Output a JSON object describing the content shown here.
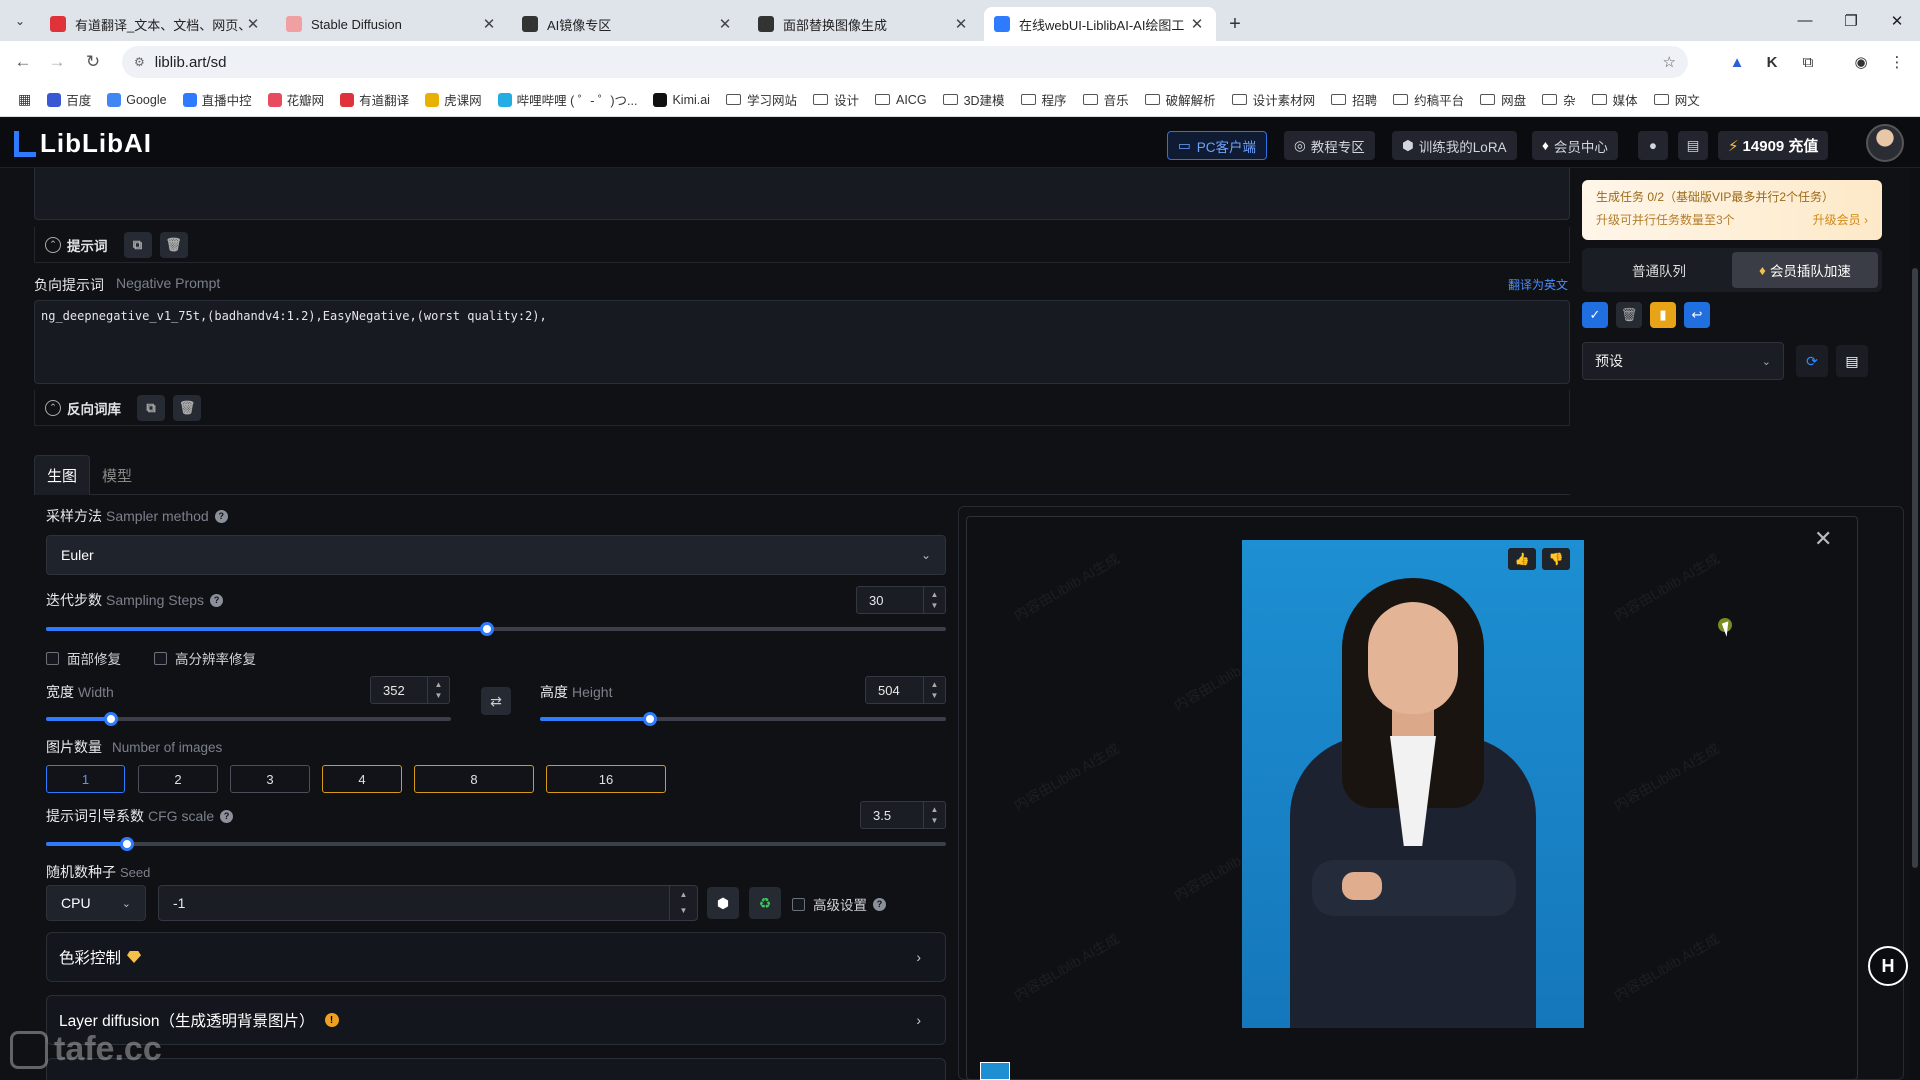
{
  "browser": {
    "tabs": [
      {
        "title": "有道翻译_文本、文档、网页、",
        "icon_color": "#e0323a",
        "active": false
      },
      {
        "title": "Stable Diffusion",
        "icon_color": "#f0a0a0",
        "active": false
      },
      {
        "title": "AI镜像专区",
        "icon_color": "#333333",
        "active": false
      },
      {
        "title": "面部替换图像生成",
        "icon_color": "#333333",
        "active": false
      },
      {
        "title": "在线webUI-LiblibAI-AI绘图工",
        "icon_color": "#2f7bff",
        "active": true
      }
    ],
    "url": "liblib.art/sd",
    "bookmarks": [
      {
        "label": "百度",
        "type": "site",
        "color": "#3858d6"
      },
      {
        "label": "Google",
        "type": "site",
        "color": "#4285f4"
      },
      {
        "label": "直播中控",
        "type": "site",
        "color": "#2f7bff"
      },
      {
        "label": "花瓣网",
        "type": "site",
        "color": "#e84a5f"
      },
      {
        "label": "有道翻译",
        "type": "site",
        "color": "#e0323a"
      },
      {
        "label": "虎课网",
        "type": "site",
        "color": "#e8b000"
      },
      {
        "label": "哔哩哔哩 ( ゜- ゜)つ...",
        "type": "site",
        "color": "#23ade5"
      },
      {
        "label": "Kimi.ai",
        "type": "site",
        "color": "#111111"
      },
      {
        "label": "学习网站",
        "type": "folder"
      },
      {
        "label": "设计",
        "type": "folder"
      },
      {
        "label": "AICG",
        "type": "folder"
      },
      {
        "label": "3D建模",
        "type": "folder"
      },
      {
        "label": "程序",
        "type": "folder"
      },
      {
        "label": "音乐",
        "type": "folder"
      },
      {
        "label": "破解解析",
        "type": "folder"
      },
      {
        "label": "设计素材网",
        "type": "folder"
      },
      {
        "label": "招聘",
        "type": "folder"
      },
      {
        "label": "约稿平台",
        "type": "folder"
      },
      {
        "label": "网盘",
        "type": "folder"
      },
      {
        "label": "杂",
        "type": "folder"
      },
      {
        "label": "媒体",
        "type": "folder"
      },
      {
        "label": "网文",
        "type": "folder"
      }
    ]
  },
  "header": {
    "logo": "LibLibAI",
    "pc_client": "PC客户端",
    "tutorials": "教程专区",
    "train_lora": "训练我的LoRA",
    "member_center": "会员中心",
    "credits": "14909 充值"
  },
  "prompt": {
    "collapse_label": "提示词",
    "negative_label_cn": "负向提示词",
    "negative_label_en": "Negative Prompt",
    "translate": "翻译为英文",
    "negative_text": "ng_deepnegative_v1_75t,(badhandv4:1.2),EasyNegative,(worst quality:2),",
    "negative_lib_label": "反向词库"
  },
  "tabs": [
    "生图",
    "模型"
  ],
  "sampler": {
    "label_cn": "采样方法",
    "label_en": "Sampler method",
    "value": "Euler"
  },
  "steps": {
    "label_cn": "迭代步数",
    "label_en": "Sampling Steps",
    "value": "30",
    "fraction": 0.49
  },
  "checkboxes": {
    "face_fix": "面部修复",
    "hires_fix": "高分辨率修复"
  },
  "width": {
    "label_cn": "宽度",
    "label_en": "Width",
    "value": "352",
    "fraction": 0.16
  },
  "height": {
    "label_cn": "高度",
    "label_en": "Height",
    "value": "504",
    "fraction": 0.27
  },
  "num_images": {
    "label_cn": "图片数量",
    "label_en": "Number of images",
    "options": [
      "1",
      "2",
      "3",
      "4",
      "8",
      "16"
    ],
    "selected": "1"
  },
  "cfg": {
    "label_cn": "提示词引导系数",
    "label_en": "CFG scale",
    "value": "3.5",
    "fraction": 0.09
  },
  "seed": {
    "label_cn": "随机数种子",
    "label_en": "Seed",
    "device": "CPU",
    "value": "-1",
    "advanced": "高级设置"
  },
  "accordions": {
    "color_control": "色彩控制",
    "layer_diffusion": "Layer diffusion（生成透明背景图片）"
  },
  "side": {
    "task_line1": "生成任务 0/2（基础版VIP最多并行2个任务）",
    "task_line2": "升级可并行任务数量至3个",
    "upgrade": "升级会员 ›",
    "queue_normal": "普通队列",
    "queue_vip": "会员插队加速",
    "preset": "预设"
  },
  "watermark": {
    "preview_text": "内容由Liblib AI生成",
    "corner": "tafe.cc"
  }
}
